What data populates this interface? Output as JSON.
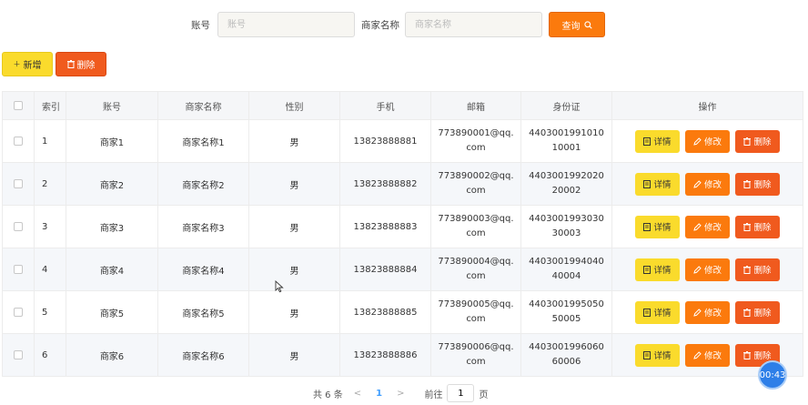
{
  "search": {
    "account_label": "账号",
    "account_placeholder": "账号",
    "merchant_label": "商家名称",
    "merchant_placeholder": "商家名称",
    "query_label": "查询"
  },
  "toolbar": {
    "add_label": "新增",
    "delete_label": "删除"
  },
  "table": {
    "headers": [
      "索引",
      "账号",
      "商家名称",
      "性别",
      "手机",
      "邮箱",
      "身份证",
      "操作"
    ],
    "rows": [
      {
        "idx": "1",
        "account": "商家1",
        "name": "商家名称1",
        "gender": "男",
        "phone": "13823888881",
        "email": "773890001@qq.com",
        "id_card": "440300199101010001"
      },
      {
        "idx": "2",
        "account": "商家2",
        "name": "商家名称2",
        "gender": "男",
        "phone": "13823888882",
        "email": "773890002@qq.com",
        "id_card": "440300199202020002"
      },
      {
        "idx": "3",
        "account": "商家3",
        "name": "商家名称3",
        "gender": "男",
        "phone": "13823888883",
        "email": "773890003@qq.com",
        "id_card": "440300199303030003"
      },
      {
        "idx": "4",
        "account": "商家4",
        "name": "商家名称4",
        "gender": "男",
        "phone": "13823888884",
        "email": "773890004@qq.com",
        "id_card": "440300199404040004"
      },
      {
        "idx": "5",
        "account": "商家5",
        "name": "商家名称5",
        "gender": "男",
        "phone": "13823888885",
        "email": "773890005@qq.com",
        "id_card": "440300199505050005"
      },
      {
        "idx": "6",
        "account": "商家6",
        "name": "商家名称6",
        "gender": "男",
        "phone": "13823888886",
        "email": "773890006@qq.com",
        "id_card": "440300199606060006"
      }
    ],
    "op_detail": "详情",
    "op_edit": "修改",
    "op_delete": "删除"
  },
  "pagination": {
    "total": "共 6 条",
    "current_page": "1",
    "goto_label": "前往",
    "goto_value": "1",
    "page_suffix": "页"
  },
  "timer": {
    "value": "00:43"
  },
  "colors": {
    "yellow": "#fadb2c",
    "orange": "#fb7a0d",
    "red": "#f05a1e",
    "link_blue": "#409eff"
  },
  "icons": {
    "query": "search-icon",
    "add": "plus-icon",
    "delete": "trash-icon",
    "detail": "document-icon",
    "edit": "pencil-icon"
  }
}
